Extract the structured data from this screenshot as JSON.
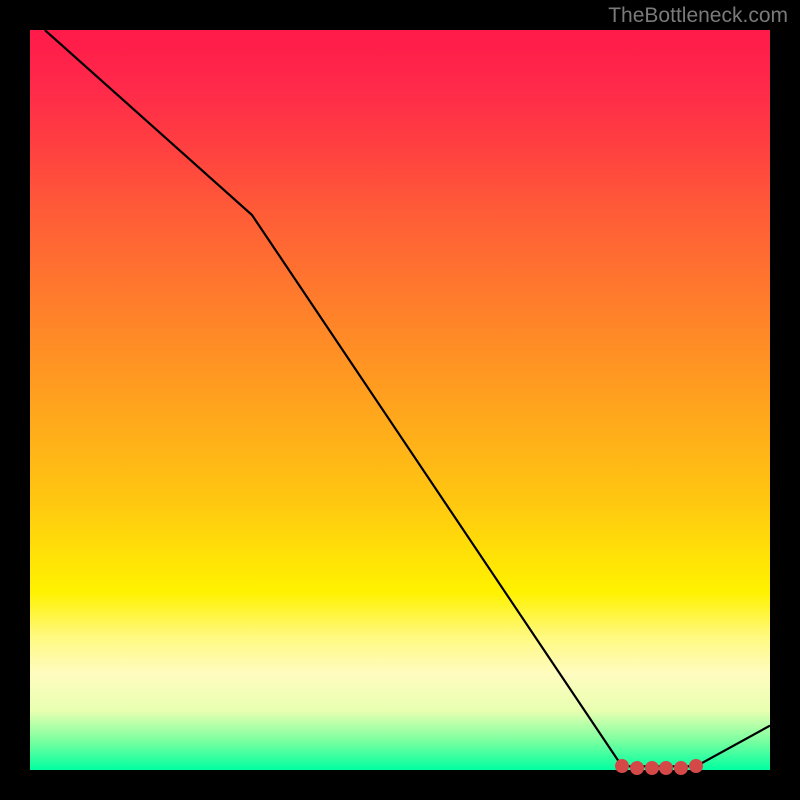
{
  "watermark": "TheBottleneck.com",
  "chart_data": {
    "type": "line",
    "title": "",
    "xlabel": "",
    "ylabel": "",
    "xlim": [
      0,
      100
    ],
    "ylim": [
      0,
      100
    ],
    "grid": false,
    "series": [
      {
        "name": "curve",
        "color": "#000000",
        "points": [
          {
            "x": 2,
            "y": 100
          },
          {
            "x": 30,
            "y": 75
          },
          {
            "x": 80,
            "y": 0.5
          },
          {
            "x": 90,
            "y": 0.5
          },
          {
            "x": 100,
            "y": 6
          }
        ]
      }
    ],
    "markers": {
      "color": "#d44848",
      "points": [
        {
          "x": 80,
          "y": 0.5
        },
        {
          "x": 82,
          "y": 0.3
        },
        {
          "x": 84,
          "y": 0.3
        },
        {
          "x": 86,
          "y": 0.3
        },
        {
          "x": 88,
          "y": 0.3
        },
        {
          "x": 90,
          "y": 0.5
        }
      ]
    },
    "background": "heat-gradient-red-to-green"
  }
}
